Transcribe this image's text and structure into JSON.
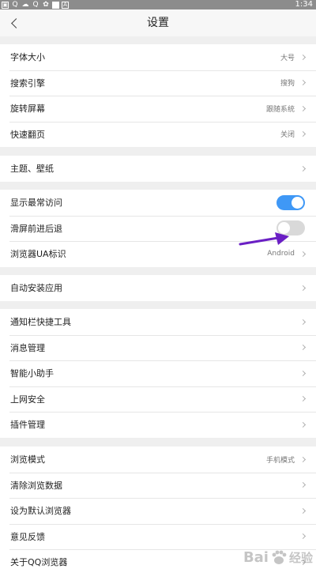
{
  "status_bar": {
    "time": "1:34",
    "icons": [
      "notification-icon",
      "qq-browser-icon",
      "weather-icon",
      "qq-icon",
      "app-icon",
      "square-icon",
      "a-icon"
    ]
  },
  "header": {
    "title": "设置"
  },
  "sections": [
    {
      "rows": [
        {
          "label": "字体大小",
          "value": "大号",
          "chevron": true
        },
        {
          "label": "搜索引擎",
          "value": "搜狗",
          "chevron": true
        },
        {
          "label": "旋转屏幕",
          "value": "跟随系统",
          "chevron": true
        },
        {
          "label": "快速翻页",
          "value": "关闭",
          "chevron": true
        }
      ]
    },
    {
      "rows": [
        {
          "label": "主题、壁纸",
          "value": "",
          "chevron": true
        }
      ]
    },
    {
      "rows": [
        {
          "label": "显示最常访问",
          "toggle": true,
          "toggle_on": true
        },
        {
          "label": "滑屏前进后退",
          "toggle": true,
          "toggle_on": false
        },
        {
          "label": "浏览器UA标识",
          "value": "Android",
          "chevron": true
        }
      ]
    },
    {
      "rows": [
        {
          "label": "自动安装应用",
          "value": "",
          "chevron": true
        }
      ]
    },
    {
      "rows": [
        {
          "label": "通知栏快捷工具",
          "value": "",
          "chevron": true
        },
        {
          "label": "消息管理",
          "value": "",
          "chevron": true
        },
        {
          "label": "智能小助手",
          "value": "",
          "chevron": true
        },
        {
          "label": "上网安全",
          "value": "",
          "chevron": true
        },
        {
          "label": "插件管理",
          "value": "",
          "chevron": true
        }
      ]
    },
    {
      "rows": [
        {
          "label": "浏览模式",
          "value": "手机模式",
          "chevron": true
        },
        {
          "label": "清除浏览数据",
          "value": "",
          "chevron": true
        },
        {
          "label": "设为默认浏览器",
          "value": "",
          "chevron": true
        },
        {
          "label": "意见反馈",
          "value": "",
          "chevron": true
        },
        {
          "label": "关于QQ浏览器",
          "value": "",
          "chevron": true
        }
      ]
    }
  ],
  "colors": {
    "toggle_on": "#3f98f6",
    "toggle_off": "#d9d9d9",
    "annotation_arrow": "#6a1fc4",
    "background": "#efefef"
  },
  "watermark": {
    "text": "Bai",
    "text2": "经验"
  }
}
